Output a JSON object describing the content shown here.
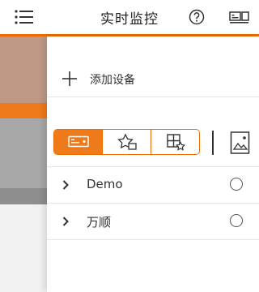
{
  "header": {
    "title": "实时监控",
    "left_icon": "menu-icon",
    "right_icons": [
      "help-icon",
      "device-list-icon"
    ],
    "accent_color": "#ef6c00"
  },
  "drawer": {
    "add_device_label": "添加设备",
    "view_tabs": [
      {
        "icon": "device-view-icon",
        "active": true
      },
      {
        "icon": "favorites-view-icon",
        "active": false
      },
      {
        "icon": "layout-favorite-icon",
        "active": false
      }
    ],
    "extra_button_icon": "picture-icon",
    "devices": [
      {
        "name": "Demo",
        "selected": false
      },
      {
        "name": "万顺",
        "selected": false
      }
    ]
  }
}
